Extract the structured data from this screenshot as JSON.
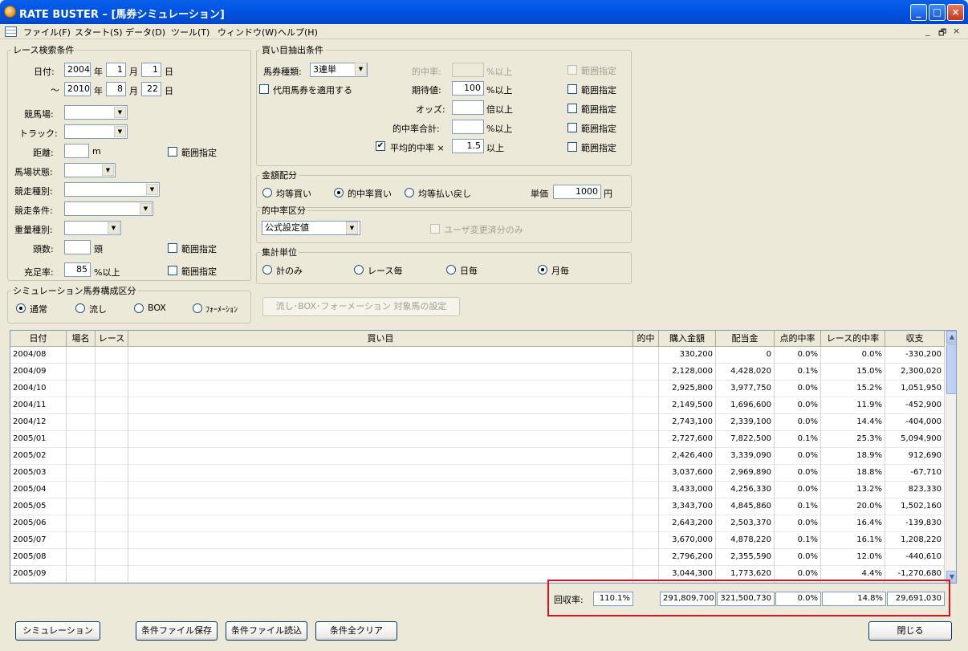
{
  "window": {
    "title": "RATE BUSTER – [馬券シミュレーション]",
    "minimize": "_",
    "maximize": "□",
    "close": "×"
  },
  "menu": [
    {
      "label": "ファイル(F)"
    },
    {
      "label": "スタート(S)"
    },
    {
      "label": "データ(D)"
    },
    {
      "label": "ツール(T)"
    },
    {
      "label": "ウィンドウ(W)"
    },
    {
      "label": "ヘルプ(H)"
    }
  ],
  "mdi": {
    "min": "_",
    "restore": "🗗",
    "close": "×"
  },
  "race": {
    "legend": "レース検索条件",
    "date_label": "日付:",
    "tilde": "～",
    "year_unit": "年",
    "month_unit": "月",
    "day_unit": "日",
    "from": {
      "year": "2004",
      "month": "1",
      "day": "1"
    },
    "to": {
      "year": "2010",
      "month": "8",
      "day": "22"
    },
    "track_label": "競馬場:",
    "course_label": "トラック:",
    "distance_label": "距離:",
    "distance_unit": "m",
    "condition_label": "馬場状態:",
    "race_type_label": "競走種別:",
    "race_cond_label": "競走条件:",
    "weight_label": "重量種別:",
    "heads_label": "頭数:",
    "heads_unit": "頭",
    "fill_label": "充足率:",
    "fill_value": "85",
    "fill_unit": "%以上",
    "range_label": "範囲指定"
  },
  "bet": {
    "legend": "買い目抽出条件",
    "type_label": "馬券種類:",
    "type_value": "3連単",
    "substitute_label": "代用馬券を適用する",
    "hit_label": "的中率:",
    "hit_unit": "%以上",
    "ev_label": "期待値:",
    "ev_value": "100",
    "ev_unit": "%以上",
    "odds_label": "オッズ:",
    "odds_unit": "倍以上",
    "hit_total_label": "的中率合計:",
    "hit_total_unit": "%以上",
    "avg_label": "平均的中率 ×",
    "avg_value": "1.5",
    "avg_unit": "以上",
    "check_mark": "✔",
    "range_label": "範囲指定"
  },
  "amount": {
    "legend": "金額配分",
    "opt1": "均等買い",
    "opt2": "的中率買い",
    "opt3": "均等払い戻し",
    "unit_label": "単価",
    "unit_value": "1000",
    "unit_currency": "円"
  },
  "hitclass": {
    "legend": "的中率区分",
    "value": "公式設定値",
    "user_only": "ユーザ変更済分のみ"
  },
  "agg": {
    "legend": "集計単位",
    "opt1": "計のみ",
    "opt2": "レース毎",
    "opt3": "日毎",
    "opt4": "月毎"
  },
  "sim": {
    "legend": "シミュレーション馬券構成区分",
    "opt1": "通常",
    "opt2": "流し",
    "opt3": "BOX",
    "opt4": "ﾌｫｰﾒｰｼｮﾝ",
    "setup_button": "流し･BOX･フォーメーション 対象馬の設定"
  },
  "grid": {
    "headers": [
      "日付",
      "場名",
      "レース",
      "買い目",
      "的中",
      "購入金額",
      "配当金",
      "点的中率",
      "レース的中率",
      "収支"
    ],
    "rows": [
      [
        "2004/08",
        "",
        "",
        "",
        "",
        "330,200",
        "0",
        "0.0%",
        "0.0%",
        "-330,200"
      ],
      [
        "2004/09",
        "",
        "",
        "",
        "",
        "2,128,000",
        "4,428,020",
        "0.1%",
        "15.0%",
        "2,300,020"
      ],
      [
        "2004/10",
        "",
        "",
        "",
        "",
        "2,925,800",
        "3,977,750",
        "0.0%",
        "15.2%",
        "1,051,950"
      ],
      [
        "2004/11",
        "",
        "",
        "",
        "",
        "2,149,500",
        "1,696,600",
        "0.0%",
        "11.9%",
        "-452,900"
      ],
      [
        "2004/12",
        "",
        "",
        "",
        "",
        "2,743,100",
        "2,339,100",
        "0.0%",
        "14.4%",
        "-404,000"
      ],
      [
        "2005/01",
        "",
        "",
        "",
        "",
        "2,727,600",
        "7,822,500",
        "0.1%",
        "25.3%",
        "5,094,900"
      ],
      [
        "2005/02",
        "",
        "",
        "",
        "",
        "2,426,400",
        "3,339,090",
        "0.0%",
        "18.9%",
        "912,690"
      ],
      [
        "2005/03",
        "",
        "",
        "",
        "",
        "3,037,600",
        "2,969,890",
        "0.0%",
        "18.8%",
        "-67,710"
      ],
      [
        "2005/04",
        "",
        "",
        "",
        "",
        "3,433,000",
        "4,256,330",
        "0.0%",
        "13.2%",
        "823,330"
      ],
      [
        "2005/05",
        "",
        "",
        "",
        "",
        "3,343,700",
        "4,845,860",
        "0.1%",
        "20.0%",
        "1,502,160"
      ],
      [
        "2005/06",
        "",
        "",
        "",
        "",
        "2,643,200",
        "2,503,370",
        "0.0%",
        "16.4%",
        "-139,830"
      ],
      [
        "2005/07",
        "",
        "",
        "",
        "",
        "3,670,000",
        "4,878,220",
        "0.1%",
        "16.1%",
        "1,208,220"
      ],
      [
        "2005/08",
        "",
        "",
        "",
        "",
        "2,796,200",
        "2,355,590",
        "0.0%",
        "12.0%",
        "-440,610"
      ],
      [
        "2005/09",
        "",
        "",
        "",
        "",
        "3,044,300",
        "1,773,620",
        "0.0%",
        "4.4%",
        "-1,270,680"
      ]
    ]
  },
  "totals": {
    "recovery_label": "回収率:",
    "recovery_value": "110.1%",
    "purchase": "291,809,700",
    "payout": "321,500,730",
    "point_hit": "0.0%",
    "race_hit": "14.8%",
    "balance": "29,691,030"
  },
  "buttons": {
    "simulate": "シミュレーション",
    "save": "条件ファイル保存",
    "load": "条件ファイル読込",
    "clear": "条件全クリア",
    "close": "閉じる"
  },
  "icons": {
    "arrow_down": "▼",
    "arrow_up": "▲"
  }
}
